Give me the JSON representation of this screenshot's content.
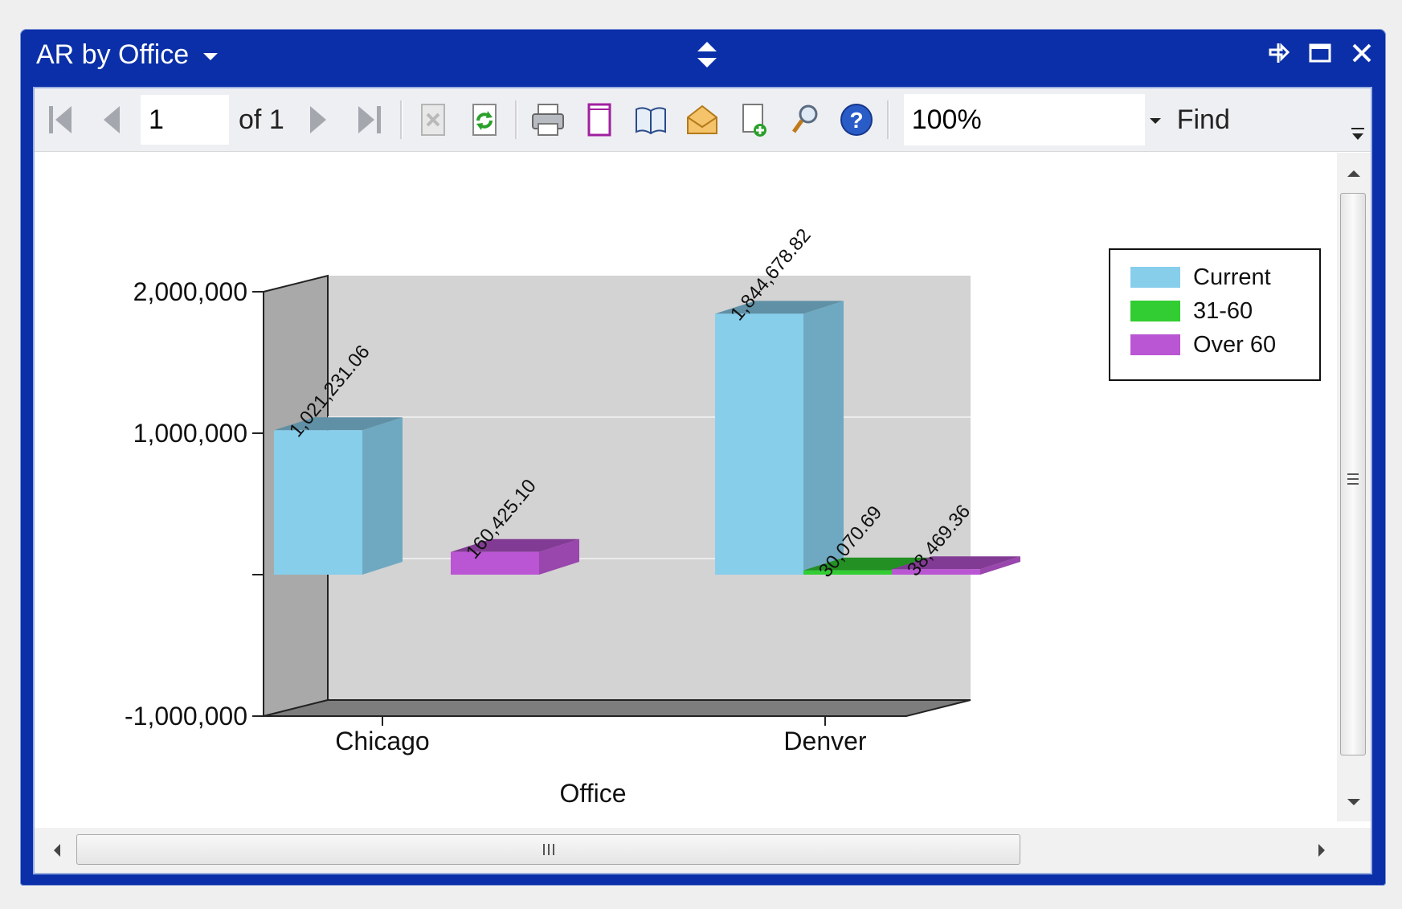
{
  "window": {
    "title": "AR by Office"
  },
  "toolbar": {
    "page_value": "1",
    "of_label": "of",
    "total_pages": "1",
    "zoom": "100%",
    "find_label": "Find"
  },
  "colors": {
    "current": "#87ceeb",
    "31-60": "#32cd32",
    "over60": "#ba55d3",
    "titlebar": "#0a2fa8"
  },
  "icons": [
    "first-page-icon",
    "prev-page-icon",
    "next-page-icon",
    "last-page-icon",
    "stop-icon",
    "refresh-icon",
    "print-icon",
    "page-layout-icon",
    "toggle-doc-map-icon",
    "email-icon",
    "export-icon",
    "search-icon",
    "help-icon"
  ],
  "chart_data": {
    "type": "bar",
    "title": "",
    "xlabel": "Office",
    "ylabel": "",
    "categories": [
      "Chicago",
      "Denver"
    ],
    "series": [
      {
        "name": "Current",
        "values": [
          1021231.06,
          1844678.82
        ],
        "labels": [
          "1,021,231.06",
          "1,844,678.82"
        ]
      },
      {
        "name": "31-60",
        "values": [
          0,
          30070.69
        ],
        "labels": [
          "",
          "30,070.69"
        ]
      },
      {
        "name": "Over 60",
        "values": [
          160425.1,
          38469.36
        ],
        "labels": [
          "160,425.10",
          "38,469.36"
        ]
      }
    ],
    "ylim": [
      -1000000,
      2000000
    ],
    "yticks": [
      {
        "value": 2000000,
        "label": "2,000,000"
      },
      {
        "value": 1000000,
        "label": "1,000,000"
      },
      {
        "value": 0,
        "label": ""
      },
      {
        "value": -1000000,
        "label": "-1,000,000"
      }
    ],
    "grid": true,
    "legend": "top-right",
    "style": "3d"
  }
}
